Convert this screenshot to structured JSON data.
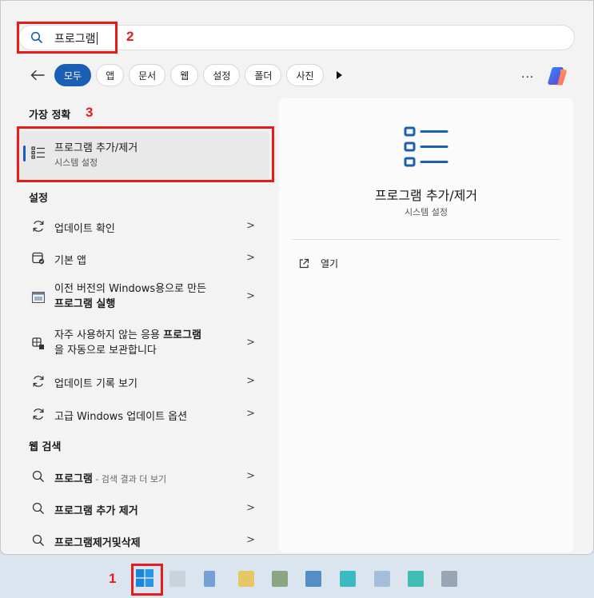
{
  "search": {
    "query": "프로그램"
  },
  "annotations": {
    "n1": "1",
    "n2": "2",
    "n3": "3"
  },
  "filters": [
    "모두",
    "앱",
    "문서",
    "웹",
    "설정",
    "폴더",
    "사진"
  ],
  "more_label": "...",
  "sections": {
    "best": "가장 정확",
    "settings": "설정",
    "web": "웹 검색"
  },
  "best_match": {
    "title": "프로그램 추가/제거",
    "subtitle": "시스템 설정"
  },
  "settings_items": [
    {
      "label": "업데이트 확인",
      "icon": "sync-icon"
    },
    {
      "label": "기본 앱",
      "icon": "default-apps-icon"
    },
    {
      "line1": "이전 버전의 Windows용으로 만든",
      "line2": "프로그램 실행",
      "icon": "compat-icon"
    },
    {
      "line1": "자주 사용하지 않는 응용 프로그램",
      "line2": "을 자동으로 보관합니다",
      "icon": "archive-apps-icon"
    },
    {
      "label": "업데이트 기록 보기",
      "icon": "sync-icon"
    },
    {
      "label": "고급 Windows 업데이트 옵션",
      "icon": "sync-icon"
    }
  ],
  "web_items": [
    {
      "label": "프로그램",
      "suffix": " - 검색 결과 더 보기"
    },
    {
      "label": "프로그램 추가 제거"
    },
    {
      "label": "프로그램제거및삭제"
    }
  ],
  "detail": {
    "title": "프로그램 추가/제거",
    "subtitle": "시스템 설정",
    "open": "열기"
  },
  "colors": {
    "accent": "#1b5fb4",
    "annotation": "#e81b1b"
  }
}
